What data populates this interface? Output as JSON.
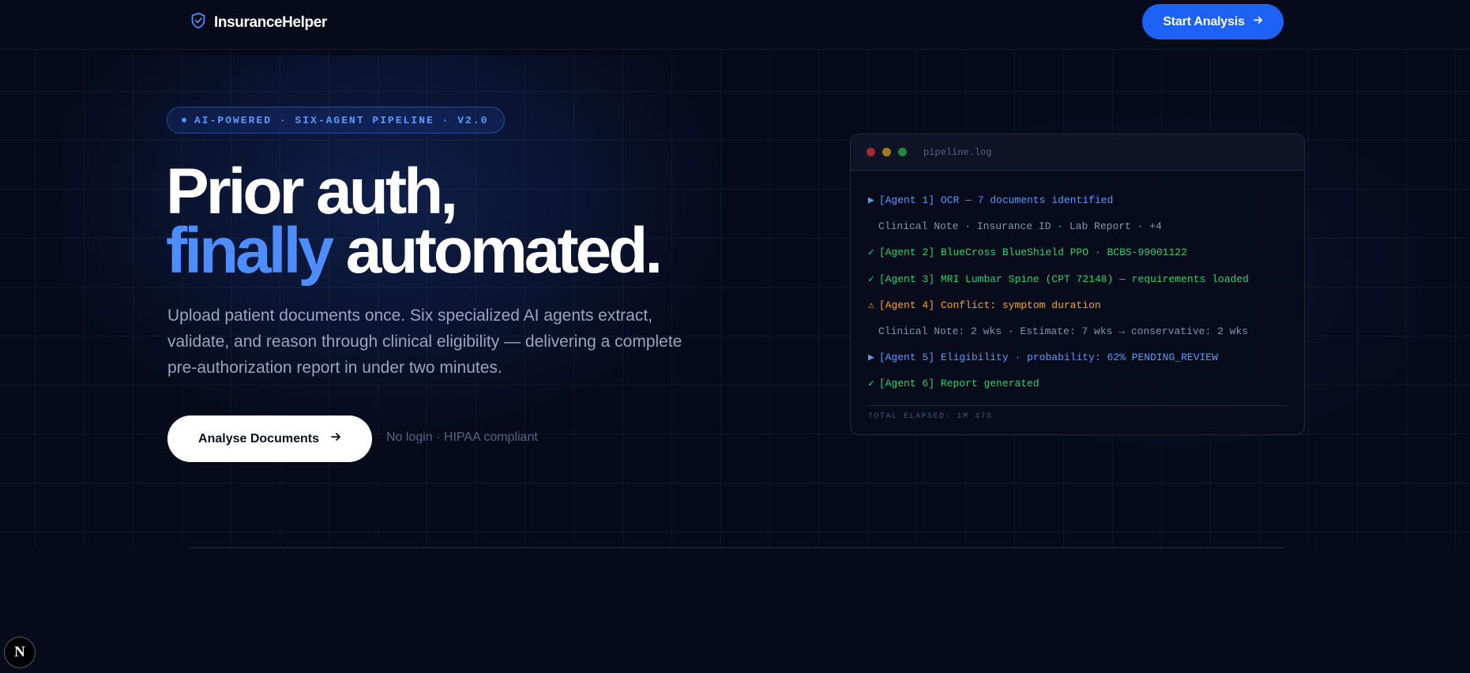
{
  "header": {
    "brand_name": "InsuranceHelper",
    "start_button_label": "Start Analysis"
  },
  "hero": {
    "badge": "AI-POWERED · SIX-AGENT PIPELINE · V2.0",
    "title_line1": "Prior auth,",
    "title_accent": "finally",
    "title_line2_rest": "automated.",
    "subtitle": "Upload patient documents once. Six specialized AI agents extract, validate, and reason through clinical eligibility — delivering a complete pre-authorization report in under two minutes.",
    "cta_label": "Analyse Documents",
    "cta_note": "No login · HIPAA compliant"
  },
  "terminal": {
    "filename": "pipeline.log",
    "lines": [
      {
        "mark": "▶",
        "text": "[Agent 1] OCR — 7 documents identified",
        "style": "blue"
      },
      {
        "mark": "",
        "text": "Clinical Note · Insurance ID · Lab Report · +4",
        "style": "sub"
      },
      {
        "mark": "✓",
        "text": "[Agent 2] BlueCross BlueShield PPO · BCBS-99001122",
        "style": "green"
      },
      {
        "mark": "✓",
        "text": "[Agent 3] MRI Lumbar Spine (CPT 72148) — requirements loaded",
        "style": "green"
      },
      {
        "mark": "⚠",
        "text": "[Agent 4] Conflict: symptom duration",
        "style": "orange"
      },
      {
        "mark": "",
        "text": "Clinical Note: 2 wks · Estimate: 7 wks → conservative: 2 wks",
        "style": "sub"
      },
      {
        "mark": "▶",
        "text": "[Agent 5] Eligibility · probability: 62% PENDING_REVIEW",
        "style": "blue"
      },
      {
        "mark": "✓",
        "text": "[Agent 6] Report generated",
        "style": "green"
      }
    ],
    "footer": "TOTAL ELAPSED: 1M 47S"
  },
  "dev_badge": {
    "letter": "N"
  },
  "colors": {
    "background": "#060a1a",
    "accent": "#4d8dff",
    "primary_button": "#1e62f5",
    "success": "#2fd06a",
    "warning": "#f5a623"
  }
}
